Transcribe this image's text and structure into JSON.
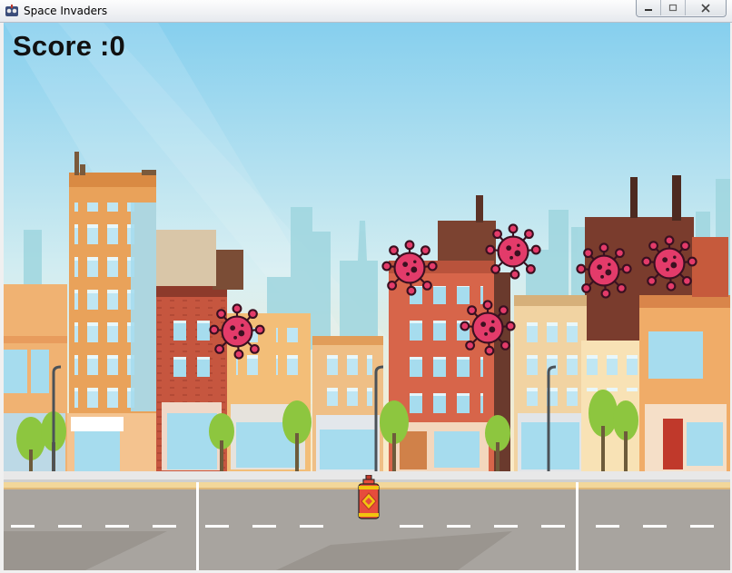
{
  "window": {
    "title": "Space Invaders",
    "icon": "game-app-icon",
    "controls": [
      "minimize",
      "maximize",
      "close"
    ]
  },
  "game": {
    "score_label": "Score :0",
    "score": 0,
    "enemy_count": 6,
    "enemy_type": "virus",
    "player": "spray-canister"
  },
  "colors": {
    "sky_top": "#8fd3ef",
    "sky_bottom": "#fbe9c2",
    "virus": "#e33b6a",
    "virus_outline": "#3a1020",
    "road": "#a8a49f",
    "player": "#e84c3d"
  }
}
